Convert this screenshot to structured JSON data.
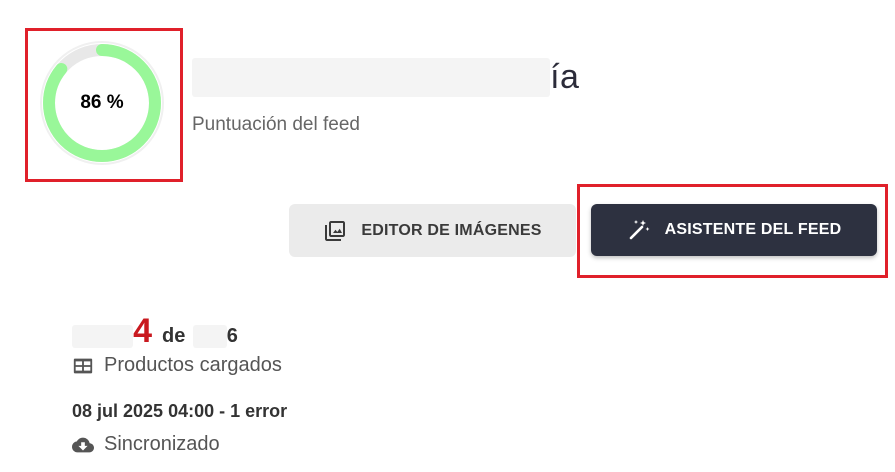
{
  "score": {
    "value": "86 %",
    "percent": 86,
    "track_color": "#e8e8e8",
    "fill_color": "#99f799"
  },
  "feed": {
    "name_visible": "ía",
    "subtitle": "Puntuación del feed"
  },
  "actions": {
    "image_editor_label": "EDITOR DE IMÁGENES",
    "image_editor_icon": "image-stack-icon",
    "feed_wizard_label": "ASISTENTE DEL FEED",
    "feed_wizard_icon": "magic-wand-icon"
  },
  "stats": {
    "loaded_count_visible": "4",
    "of_label": "de",
    "total_visible": "6",
    "products_label": "Productos cargados",
    "products_icon": "table-icon",
    "sync_time": "08 jul 2025 04:00 - 1 error",
    "sync_label": "Sincronizado",
    "sync_icon": "cloud-download-icon"
  },
  "colors": {
    "highlight": "#e0202a",
    "primary_button": "#2d3140",
    "secondary_button": "#ebebeb",
    "count_accent": "#c9191f"
  }
}
